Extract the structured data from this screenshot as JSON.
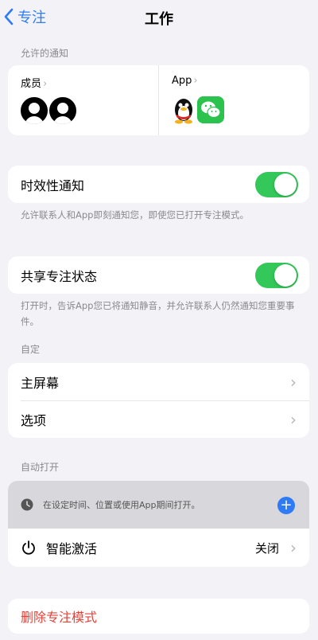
{
  "nav": {
    "back_label": "专注",
    "title": "工作"
  },
  "allowed_notifications": {
    "section_label": "允许的通知",
    "people_label": "成员",
    "apps_label": "App",
    "apps_icons": [
      "qq-icon",
      "wechat-icon"
    ]
  },
  "time_sensitive": {
    "label": "时效性通知",
    "enabled": true,
    "footnote": "允许联系人和App即刻通知您，即使您已打开专注模式。"
  },
  "share_status": {
    "label": "共享专注状态",
    "enabled": true,
    "footnote": "打开时，告诉App您已将通知静音，并允许联系人仍然通知您重要事件。"
  },
  "customize": {
    "section_label": "自定",
    "items": [
      {
        "label": "主屏幕"
      },
      {
        "label": "选项"
      }
    ]
  },
  "auto_on": {
    "section_label": "自动打开",
    "schedule_hint": "在设定时间、位置或使用App期间打开。",
    "smart_activation_label": "智能激活",
    "smart_activation_value": "关闭"
  },
  "delete_label": "删除专注模式",
  "colors": {
    "accent": "#2f7bf6",
    "toggle_on": "#34c759",
    "destructive": "#e0433a",
    "background": "#f2f2f7"
  }
}
